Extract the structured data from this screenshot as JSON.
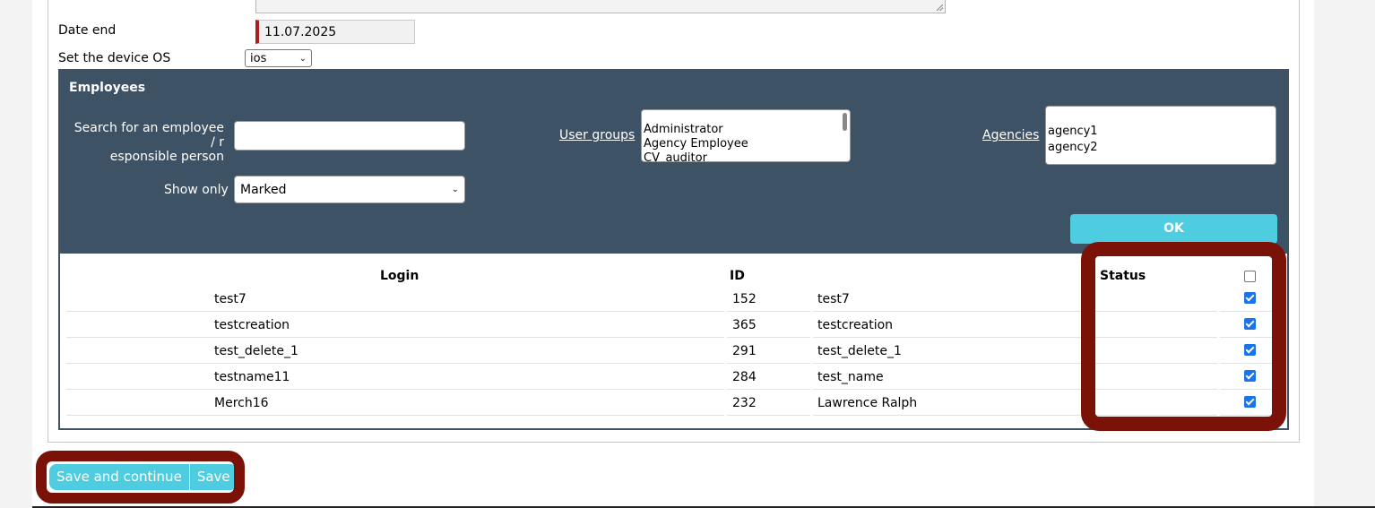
{
  "form": {
    "date_end_label": "Date end",
    "date_end_value": "11.07.2025",
    "os_label": "Set the device OS",
    "os_value": "ios"
  },
  "employees": {
    "title": "Employees",
    "search_label": "Search for an employee / responsible person",
    "search_label_line1": "Search for an employee / r",
    "search_label_line2": "esponsible person",
    "search_value": "",
    "show_only_label": "Show only",
    "show_only_value": "Marked",
    "user_groups_label": "User groups",
    "user_groups_options": [
      "Administrator",
      "Agency Employee",
      "CV_auditor"
    ],
    "agencies_label": "Agencies",
    "agencies_options": [
      "agency1",
      "agency2"
    ],
    "ok_label": "OK"
  },
  "table": {
    "headers": {
      "login": "Login",
      "id": "ID",
      "status": "Status"
    },
    "select_all_checked": false,
    "rows": [
      {
        "login": "test7",
        "id": "152",
        "name": "test7",
        "checked": true
      },
      {
        "login": "testcreation",
        "id": "365",
        "name": "testcreation",
        "checked": true
      },
      {
        "login": "test_delete_1",
        "id": "291",
        "name": "test_delete_1",
        "checked": true
      },
      {
        "login": "testname11",
        "id": "284",
        "name": "test_name",
        "checked": true
      },
      {
        "login": "Merch16",
        "id": "232",
        "name": "Lawrence Ralph",
        "checked": true
      }
    ]
  },
  "actions": {
    "save_continue_label": "Save and continue",
    "save_label": "Save"
  },
  "colors": {
    "panel": "#3e5266",
    "accent": "#4ecde0",
    "highlight": "#7a1208",
    "required_marker": "#b01c1c"
  }
}
